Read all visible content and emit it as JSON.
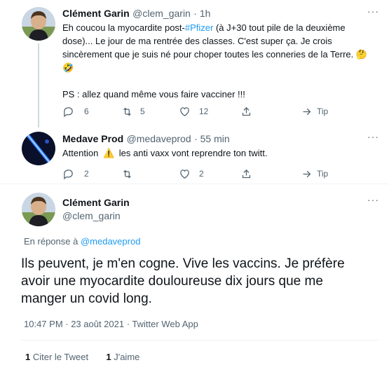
{
  "tweet1": {
    "name": "Clément Garin",
    "handle": "@clem_garin",
    "time": "· 1h",
    "line1_a": "Eh coucou la myocardite post-",
    "line1_hashtag": "#Pfizer",
    "line1_b": " (à J+30 tout pile de la deuxième",
    "line2": "dose)... Le jour de ma rentrée des classes. C'est super ça. Je crois",
    "line3": "sincèrement que je suis né pour choper toutes les conneries de la Terre.",
    "emoji_thinking": "🤔",
    "emoji_rofl": "🤣",
    "line4": "PS : allez quand même vous faire vacciner !!!",
    "reply_count": "6",
    "retweet_count": "5",
    "like_count": "12",
    "tip_label": "Tip"
  },
  "tweet2": {
    "name": "Medave Prod",
    "handle": "@medaveprod",
    "time": "· 55 min",
    "text_a": "Attention",
    "emoji_warning": "⚠️",
    "text_b": "les anti vaxx vont reprendre ton twitt.",
    "reply_count": "2",
    "retweet_count": "",
    "like_count": "2",
    "tip_label": "Tip"
  },
  "tweet3": {
    "name": "Clément Garin",
    "handle": "@clem_garin",
    "reply_prefix": "En réponse à",
    "reply_handle": "@medaveprod",
    "line1": "Ils peuvent, je m'en cogne. Vive les vaccins. Je préfère",
    "line2": "avoir une myocardite douloureuse dix jours que me",
    "line3": "manger un covid long.",
    "timestamp": "10:47 PM · 23 août 2021 · Twitter Web App",
    "quote_count": "1",
    "quote_label": "Citer le Tweet",
    "like_count": "1",
    "like_label": "J'aime"
  },
  "colors": {
    "accent": "#1d9bf0",
    "secondary_text": "#536471",
    "primary_text": "#0f1419",
    "separator": "#eff3f4"
  },
  "icons": [
    "more-icon",
    "reply-icon",
    "retweet-icon",
    "like-icon",
    "share-icon",
    "tip-icon"
  ]
}
